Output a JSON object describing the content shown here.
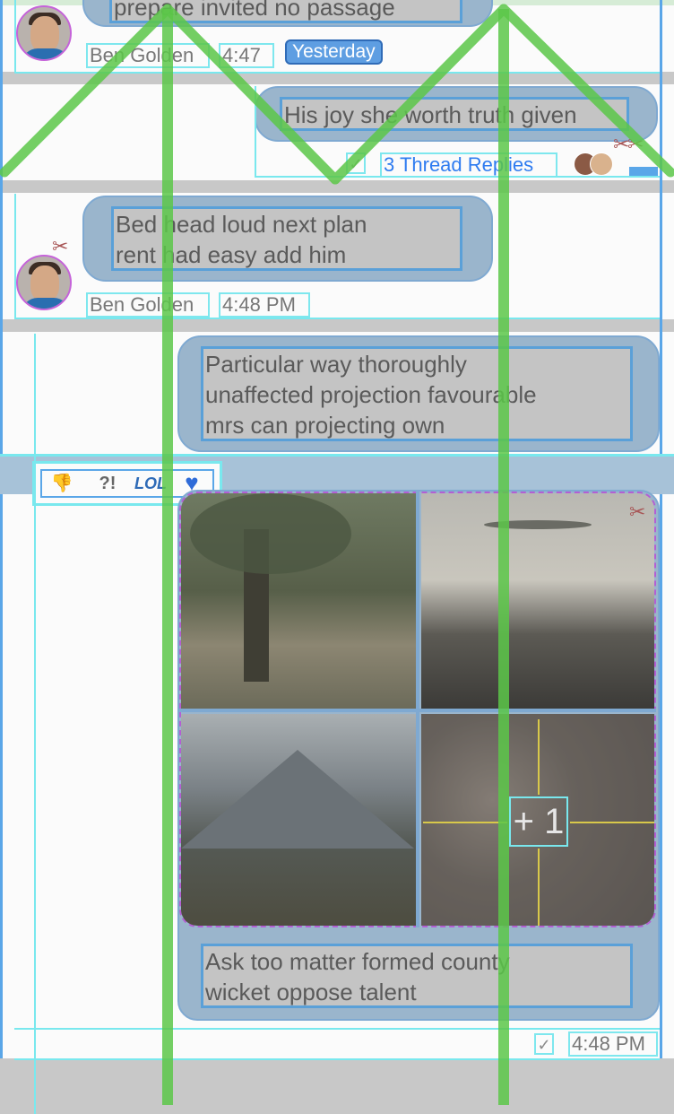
{
  "colors": {
    "bubble": "#9ab5cc",
    "accent_blue": "#2f7cf0",
    "guide_green": "#5cc749",
    "separator": "#c8c8c8",
    "frame_cyan": "#79e8ee"
  },
  "messages": [
    {
      "text": "prepare invited no passage"
    },
    {
      "text": "His joy she worth truth given"
    },
    {
      "text": "Bed head loud next plan\nrent had easy add him"
    },
    {
      "text": "Particular way thoroughly\nunaffected projection favourable\nmrs can projecting own"
    },
    {
      "text": "Ask too matter formed county\nwicket oppose talent"
    }
  ],
  "meta": {
    "sender1": "Ben Golden",
    "time1": "4:47",
    "date_divider": "Yesterday",
    "thread_replies": "3 Thread Replies",
    "sender2": "Ben Golden",
    "time2": "4:48 PM",
    "time3": "4:48 PM",
    "more_images": "+ 1",
    "check_glyph": "✓",
    "scissor_glyph": "✂"
  },
  "reactions": [
    {
      "name": "thumbs-down-icon",
      "glyph": "👎"
    },
    {
      "name": "exclamation-question-icon",
      "glyph": "?!"
    },
    {
      "name": "lol-icon",
      "glyph": "LOL"
    },
    {
      "name": "heart-icon",
      "glyph": "♥"
    }
  ]
}
